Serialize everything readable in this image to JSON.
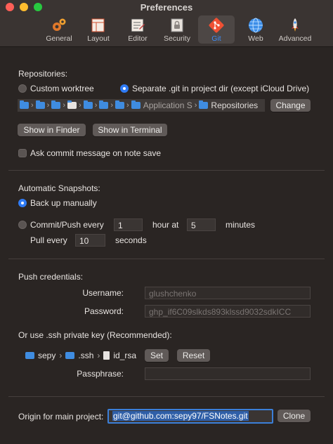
{
  "window": {
    "title": "Preferences"
  },
  "toolbar": {
    "tabs": [
      {
        "label": "General",
        "icon": "gears-icon"
      },
      {
        "label": "Layout",
        "icon": "layout-icon"
      },
      {
        "label": "Editor",
        "icon": "editor-icon"
      },
      {
        "label": "Security",
        "icon": "lock-icon"
      },
      {
        "label": "Git",
        "icon": "git-icon",
        "active": true
      },
      {
        "label": "Web",
        "icon": "globe-icon"
      },
      {
        "label": "Advanced",
        "icon": "rocket-icon"
      }
    ]
  },
  "repositories": {
    "label": "Repositories:",
    "custom_worktree": "Custom worktree",
    "separate_git": "Separate .git in project dir (except iCloud Drive)",
    "path_segments": [
      "",
      "",
      "",
      "",
      "",
      "",
      "",
      "Application S",
      "Repositories"
    ],
    "change_button": "Change",
    "show_finder_button": "Show in Finder",
    "show_terminal_button": "Show in Terminal",
    "ask_commit": "Ask commit message on note save"
  },
  "snapshots": {
    "label": "Automatic Snapshots:",
    "backup_manually": "Back up manually",
    "commit_push_every": "Commit/Push every",
    "hours_value": "1",
    "hour_at": "hour at",
    "minutes_value": "5",
    "minutes": "minutes",
    "pull_every": "Pull every",
    "pull_value": "10",
    "seconds": "seconds"
  },
  "credentials": {
    "label": "Push credentials:",
    "username_label": "Username:",
    "username_value": "glushchenko",
    "password_label": "Password:",
    "password_value": "ghp_if6C09slkds893klssd9032sdkICC",
    "ssh_label": "Or use .ssh private key (Recommended):",
    "key_path": [
      "sepy",
      ".ssh",
      "id_rsa"
    ],
    "set_button": "Set",
    "reset_button": "Reset",
    "passphrase_label": "Passphrase:",
    "passphrase_value": ""
  },
  "origin": {
    "label": "Origin for main project:",
    "value": "git@github.com:sepy97/FSNotes.git",
    "clone_button": "Clone"
  },
  "colors": {
    "accent": "#2f7bf5",
    "close": "#ff5f57",
    "minimize": "#febc2e",
    "zoom": "#28c840"
  }
}
